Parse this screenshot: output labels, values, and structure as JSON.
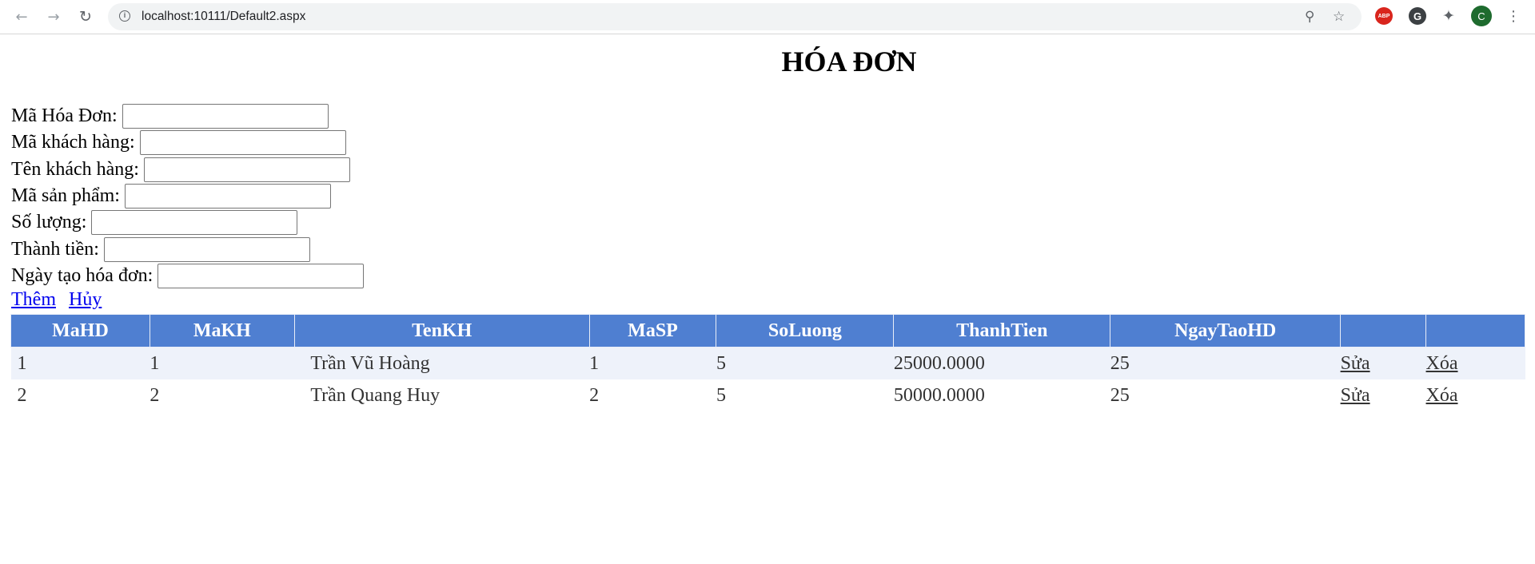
{
  "browser": {
    "url": "localhost:10111/Default2.aspx",
    "back_icon": "←",
    "forward_icon": "→",
    "reload_icon": "↻",
    "info_icon": "i",
    "zoom_icon": "⚲",
    "star_icon": "☆",
    "ext_abp": "ABP",
    "ext_2": "G",
    "puzzle_icon": "✦",
    "avatar": "C",
    "menu_icon": "⋮"
  },
  "page": {
    "title": "HÓA ĐƠN"
  },
  "form": {
    "ma_hoa_don_label": "Mã Hóa Đơn:",
    "ma_khach_hang_label": "Mã khách hàng:",
    "ten_khach_hang_label": "Tên khách hàng:",
    "ma_san_pham_label": "Mã sản phẩm:",
    "so_luong_label": "Số lượng:",
    "thanh_tien_label": "Thành tiền:",
    "ngay_tao_label": "Ngày tạo hóa đơn:",
    "ma_hoa_don_value": "",
    "ma_khach_hang_value": "",
    "ten_khach_hang_value": "",
    "ma_san_pham_value": "",
    "so_luong_value": "",
    "thanh_tien_value": "",
    "ngay_tao_value": ""
  },
  "actions": {
    "add": "Thêm",
    "cancel": "Hủy"
  },
  "grid": {
    "headers": [
      "MaHD",
      "MaKH",
      "TenKH",
      "MaSP",
      "SoLuong",
      "ThanhTien",
      "NgayTaoHD"
    ],
    "rows": [
      {
        "mahd": "1",
        "makh": "1",
        "tenkh": "Trần Vũ Hoàng",
        "masp": "1",
        "soluong": "5",
        "thanhtien": "25000.0000",
        "ngaytao": "25",
        "edit": "Sửa",
        "delete": "Xóa"
      },
      {
        "mahd": "2",
        "makh": "2",
        "tenkh": "Trần Quang Huy",
        "masp": "2",
        "soluong": "5",
        "thanhtien": "50000.0000",
        "ngaytao": "25",
        "edit": "Sửa",
        "delete": "Xóa"
      }
    ]
  },
  "colors": {
    "header_bg": "#4f7fd1",
    "alt_row_bg": "#eef2fa",
    "link": "#0000ee"
  }
}
